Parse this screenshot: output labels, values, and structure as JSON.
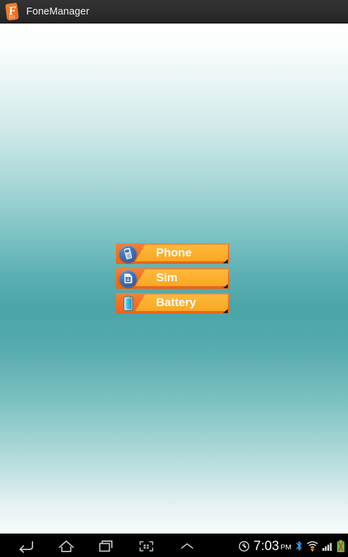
{
  "window": {
    "app_title": "FoneManager",
    "app_icon": "fonemanager-phone-f-icon"
  },
  "theme": {
    "titlebar_bg": "#2c2c2c",
    "wallpaper_top": "#ffffff",
    "wallpaper_mid": "#4aa5a8",
    "wallpaper_bottom": "#f7fbfb",
    "button_base": "#ef7224",
    "button_panel": "#fcb02f",
    "button_label": "#ffffff",
    "icon_circle": "#3a6fbf",
    "navbar_bg": "#000000"
  },
  "menu": {
    "items": [
      {
        "label": "Phone",
        "icon": "phone-icon"
      },
      {
        "label": "Sim",
        "icon": "sim-card-icon"
      },
      {
        "label": "Battery",
        "icon": "battery-icon"
      }
    ]
  },
  "navbar": {
    "back": "back-icon",
    "home": "home-icon",
    "recents": "recent-apps-icon",
    "screenshot": "screenshot-icon",
    "handle": "expand-up-icon"
  },
  "statusbar": {
    "mute": "silent-mode-icon",
    "time": "7:03",
    "ampm": "PM",
    "bluetooth": "bluetooth-icon",
    "wifi": "wifi-icon",
    "signal": "cellular-signal-icon",
    "battery": "battery-charging-icon"
  }
}
